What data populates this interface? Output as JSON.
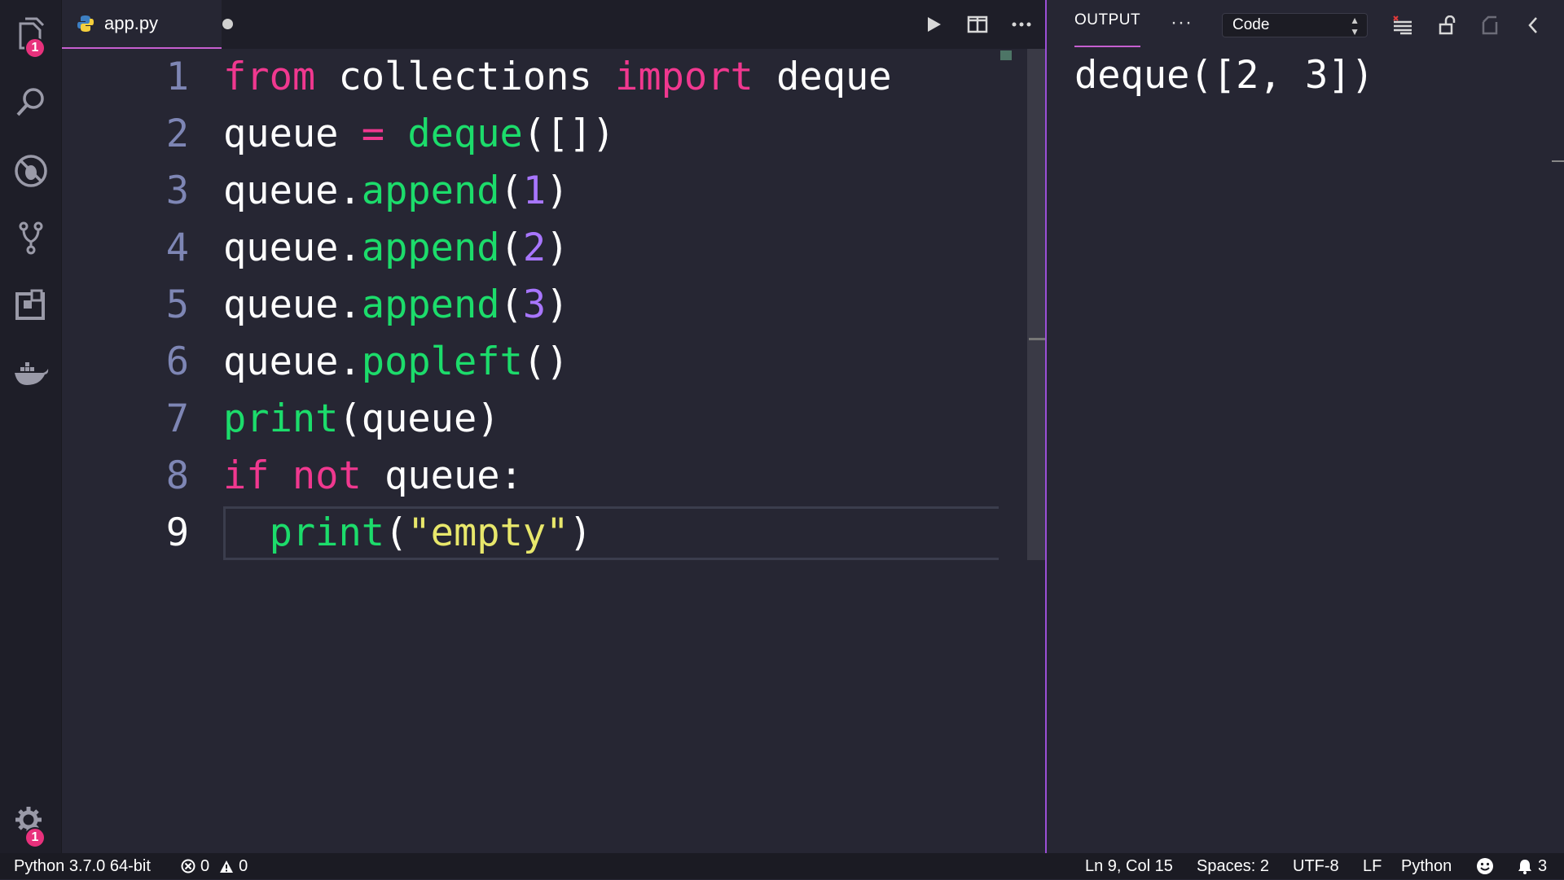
{
  "activity_bar": {
    "explorer_badge": "1",
    "settings_badge": "1"
  },
  "editor": {
    "tab_label": "app.py",
    "lines": [
      {
        "number": "1",
        "tokens": [
          {
            "t": "from",
            "c": "kw"
          },
          {
            "t": " collections ",
            "c": "plain"
          },
          {
            "t": "import",
            "c": "kw"
          },
          {
            "t": " deque",
            "c": "plain"
          }
        ]
      },
      {
        "number": "2",
        "tokens": [
          {
            "t": "queue ",
            "c": "plain"
          },
          {
            "t": "=",
            "c": "kw"
          },
          {
            "t": " ",
            "c": "plain"
          },
          {
            "t": "deque",
            "c": "fn"
          },
          {
            "t": "([])",
            "c": "plain"
          }
        ]
      },
      {
        "number": "3",
        "tokens": [
          {
            "t": "queue.",
            "c": "plain"
          },
          {
            "t": "append",
            "c": "fn"
          },
          {
            "t": "(",
            "c": "plain"
          },
          {
            "t": "1",
            "c": "num"
          },
          {
            "t": ")",
            "c": "plain"
          }
        ]
      },
      {
        "number": "4",
        "tokens": [
          {
            "t": "queue.",
            "c": "plain"
          },
          {
            "t": "append",
            "c": "fn"
          },
          {
            "t": "(",
            "c": "plain"
          },
          {
            "t": "2",
            "c": "num"
          },
          {
            "t": ")",
            "c": "plain"
          }
        ]
      },
      {
        "number": "5",
        "tokens": [
          {
            "t": "queue.",
            "c": "plain"
          },
          {
            "t": "append",
            "c": "fn"
          },
          {
            "t": "(",
            "c": "plain"
          },
          {
            "t": "3",
            "c": "num"
          },
          {
            "t": ")",
            "c": "plain"
          }
        ]
      },
      {
        "number": "6",
        "tokens": [
          {
            "t": "queue.",
            "c": "plain"
          },
          {
            "t": "popleft",
            "c": "fn"
          },
          {
            "t": "()",
            "c": "plain"
          }
        ]
      },
      {
        "number": "7",
        "tokens": [
          {
            "t": "print",
            "c": "fn"
          },
          {
            "t": "(queue)",
            "c": "plain"
          }
        ]
      },
      {
        "number": "8",
        "tokens": [
          {
            "t": "if",
            "c": "kw"
          },
          {
            "t": " ",
            "c": "plain"
          },
          {
            "t": "not",
            "c": "kw"
          },
          {
            "t": " queue:",
            "c": "plain"
          }
        ]
      },
      {
        "number": "9",
        "tokens": [
          {
            "t": "  ",
            "c": "plain"
          },
          {
            "t": "print",
            "c": "fn"
          },
          {
            "t": "(",
            "c": "plain"
          },
          {
            "t": "\"empty\"",
            "c": "str"
          },
          {
            "t": ")",
            "c": "plain"
          }
        ]
      }
    ]
  },
  "output_panel": {
    "tab_label": "OUTPUT",
    "more_label": "···",
    "selected_channel": "Code",
    "text": "deque([2, 3])"
  },
  "status_bar": {
    "interpreter": "Python 3.7.0 64-bit",
    "errors": "0",
    "warnings": "0",
    "cursor": "Ln 9, Col 15",
    "indent": "Spaces: 2",
    "encoding": "UTF-8",
    "eol": "LF",
    "language": "Python",
    "notifications": "3"
  },
  "colors": {
    "keyword": "#f0388f",
    "function": "#1cdc6b",
    "number": "#a876ff",
    "string": "#e8e76b",
    "accent": "#c65fd0",
    "badge": "#e8317c"
  }
}
